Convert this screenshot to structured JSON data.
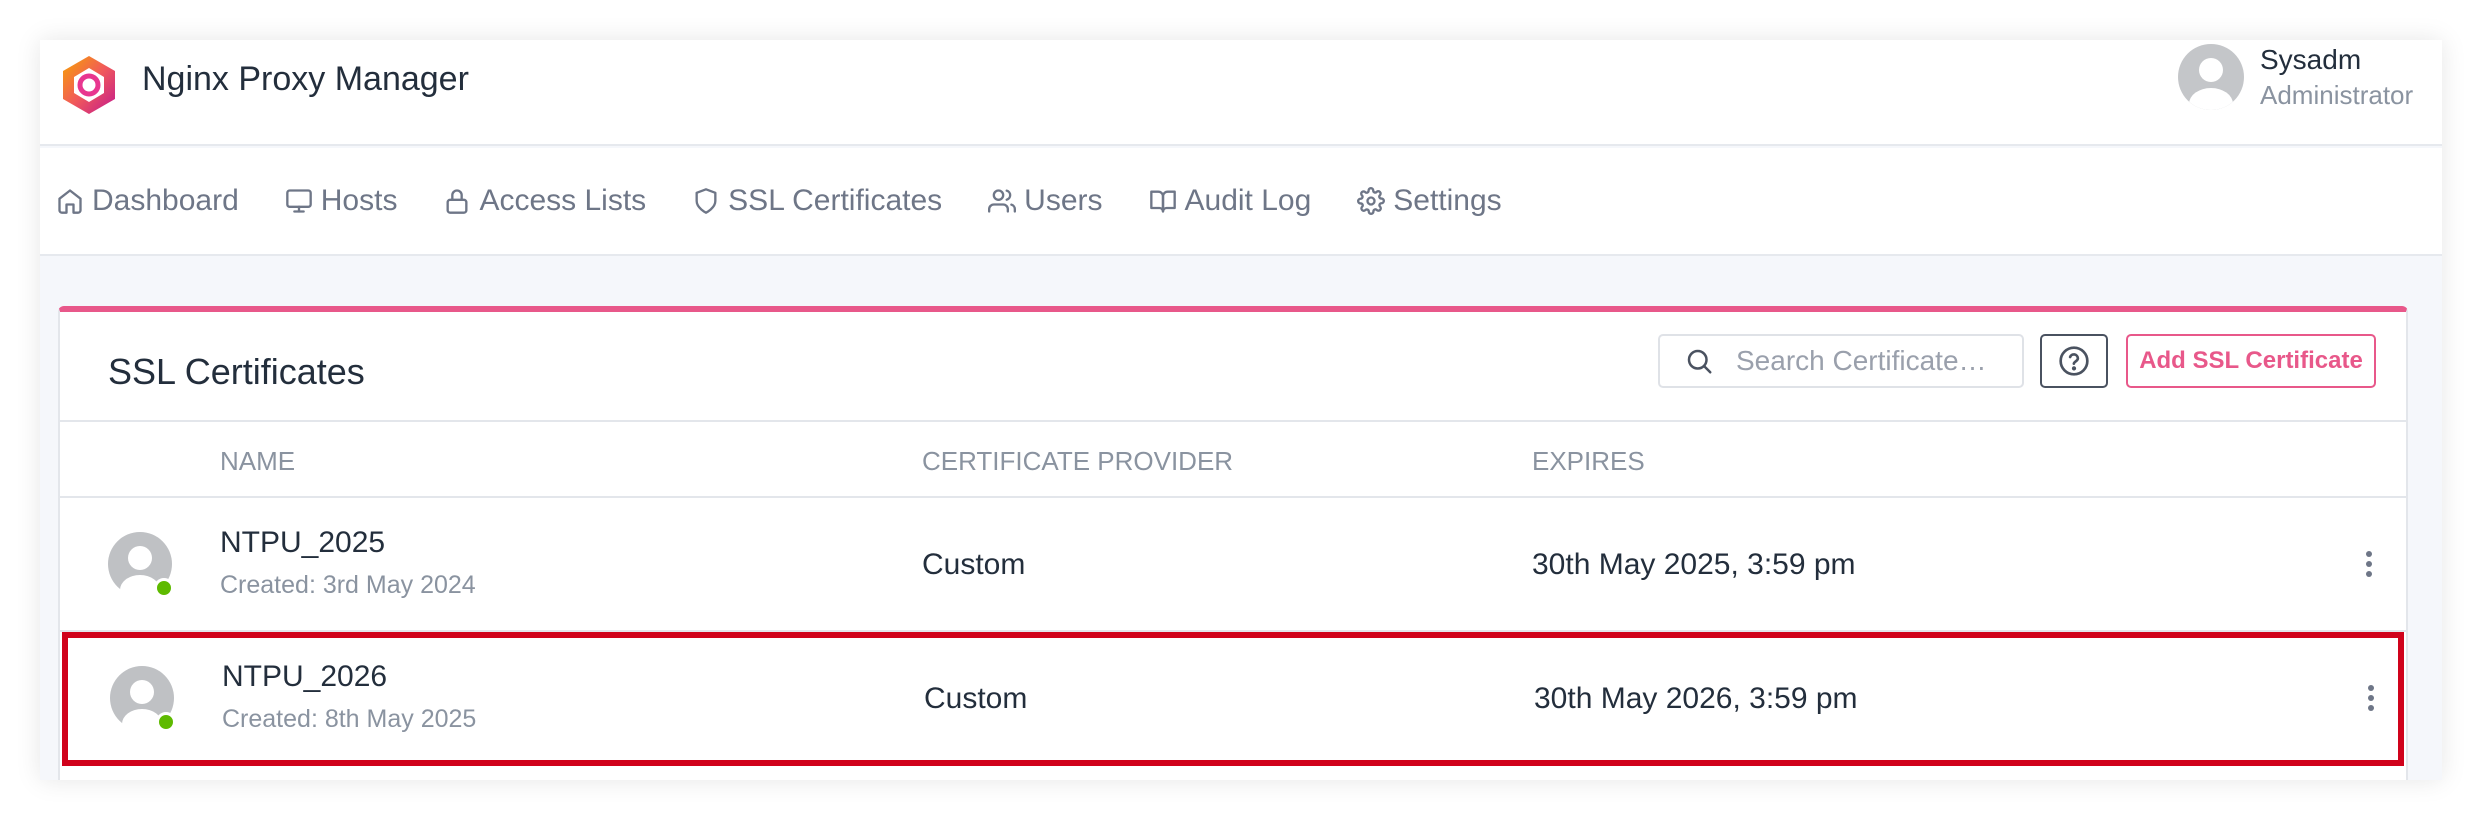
{
  "app": {
    "title": "Nginx Proxy Manager",
    "logo_icon": "nginx-proxy-manager-logo"
  },
  "user": {
    "name": "Sysadm",
    "role": "Administrator"
  },
  "nav": {
    "items": [
      {
        "label": "Dashboard",
        "icon": "home-icon"
      },
      {
        "label": "Hosts",
        "icon": "monitor-icon"
      },
      {
        "label": "Access Lists",
        "icon": "lock-icon"
      },
      {
        "label": "SSL Certificates",
        "icon": "shield-icon"
      },
      {
        "label": "Users",
        "icon": "users-icon"
      },
      {
        "label": "Audit Log",
        "icon": "book-icon"
      },
      {
        "label": "Settings",
        "icon": "gear-icon"
      }
    ]
  },
  "card": {
    "title": "SSL Certificates",
    "search_placeholder": "Search Certificate…",
    "add_button": "Add SSL Certificate",
    "accent_color": "#e8588a"
  },
  "table": {
    "headers": [
      "NAME",
      "CERTIFICATE PROVIDER",
      "EXPIRES"
    ],
    "rows": [
      {
        "name": "NTPU_2025",
        "created": "Created: 3rd May 2024",
        "provider": "Custom",
        "expires": "30th May 2025, 3:59 pm",
        "status": "online"
      },
      {
        "name": "NTPU_2026",
        "created": "Created: 8th May 2025",
        "provider": "Custom",
        "expires": "30th May 2026, 3:59 pm",
        "status": "online",
        "highlighted": true
      }
    ]
  },
  "colors": {
    "highlight_border": "#d0021b",
    "status_online": "#5eba00"
  }
}
